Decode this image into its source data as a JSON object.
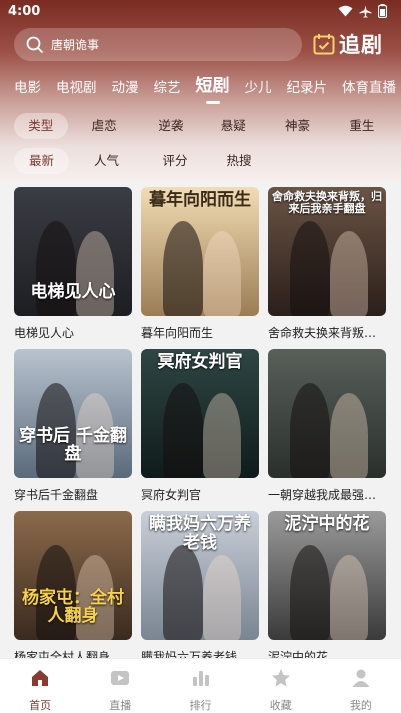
{
  "status": {
    "time": "4:00"
  },
  "search": {
    "placeholder": "唐朝诡事"
  },
  "follow": {
    "label": "追剧"
  },
  "tabs": [
    "电影",
    "电视剧",
    "动漫",
    "综艺",
    "短剧",
    "少儿",
    "纪录片",
    "体育直播"
  ],
  "active_tab": "短剧",
  "filters_type": [
    "类型",
    "虐恋",
    "逆袭",
    "悬疑",
    "神豪",
    "重生"
  ],
  "filters_sort": [
    "最新",
    "人气",
    "评分",
    "热搜"
  ],
  "cards": [
    {
      "name": "电梯见人心",
      "poster_text": "电梯见人心",
      "bg": [
        "#3b3d45",
        "#1d1e22"
      ]
    },
    {
      "name": "暮年向阳而生",
      "poster_text": "暮年向阳而生",
      "bg": [
        "#f2dcb3",
        "#9a7d55"
      ]
    },
    {
      "name": "舍命救夫换来背叛归...",
      "poster_text": "舍命救夫换来背叛，归来后我亲手翻盘",
      "bg": [
        "#6b5445",
        "#2a1f1a"
      ]
    },
    {
      "name": "穿书后千金翻盘",
      "poster_text": "穿书后 千金翻盘",
      "bg": [
        "#b9c3cf",
        "#5a6a7b"
      ]
    },
    {
      "name": "冥府女判官",
      "poster_text": "冥府女判官",
      "bg": [
        "#2f4644",
        "#0f1b1a"
      ]
    },
    {
      "name": "一朝穿越我成最强镇...",
      "poster_text": "",
      "bg": [
        "#58605a",
        "#2a2f2b"
      ]
    },
    {
      "name": "杨家屯全村人翻身从...",
      "poster_text": "杨家屯：全村人翻身",
      "bg": [
        "#8c6a4b",
        "#3a2a1e"
      ]
    },
    {
      "name": "瞒我妈六万养老钱",
      "poster_text": "瞒我妈六万养老钱",
      "bg": [
        "#c9cfd8",
        "#7a8593"
      ]
    },
    {
      "name": "泥泞中的花",
      "poster_text": "泥泞中的花",
      "bg": [
        "#9a9a9a",
        "#3a3a3a"
      ]
    }
  ],
  "nav": [
    {
      "label": "首页",
      "icon": "home-icon",
      "active": true
    },
    {
      "label": "直播",
      "icon": "live-tv-icon",
      "active": false
    },
    {
      "label": "排行",
      "icon": "ranking-icon",
      "active": false
    },
    {
      "label": "收藏",
      "icon": "star-icon",
      "active": false
    },
    {
      "label": "我的",
      "icon": "profile-icon",
      "active": false
    }
  ],
  "colors": {
    "header_top": "#7a2c22",
    "accent": "#8a3a2e"
  }
}
